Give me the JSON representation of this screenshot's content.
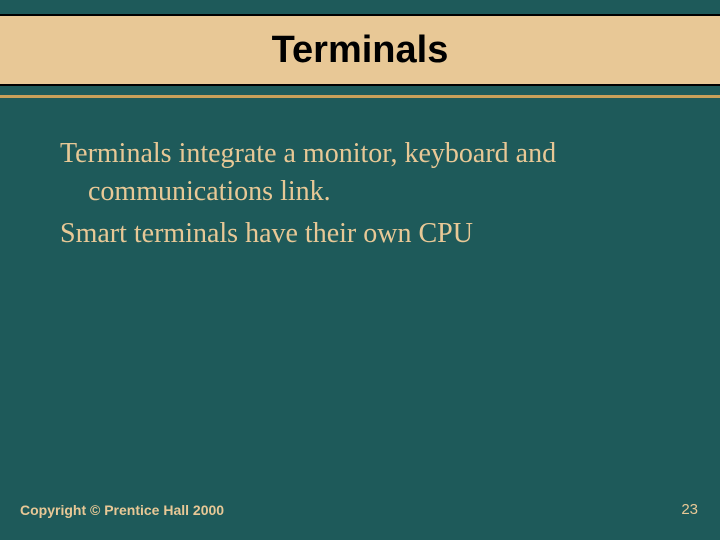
{
  "title": "Terminals",
  "body": {
    "para1": "Terminals integrate a monitor, keyboard and communications link.",
    "para2": "Smart terminals have their own CPU"
  },
  "footer": {
    "copyright": "Copyright © Prentice Hall 2000",
    "page": "23"
  }
}
